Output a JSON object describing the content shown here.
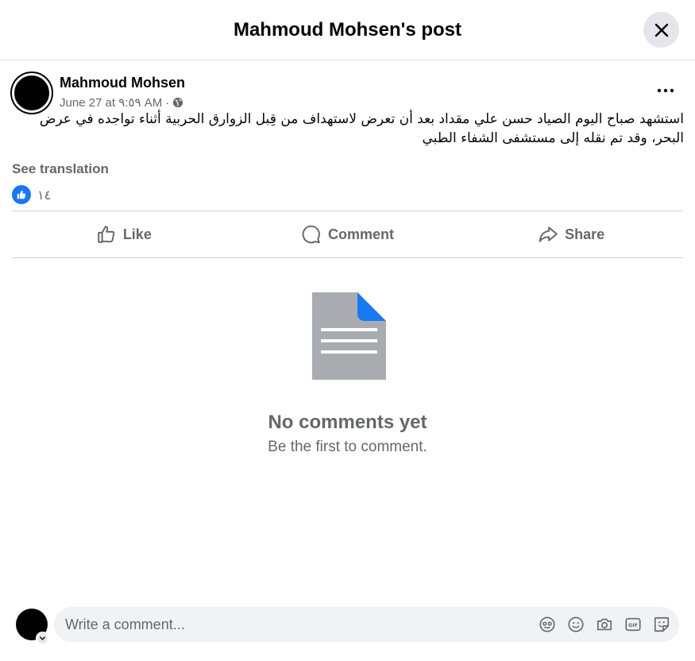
{
  "header": {
    "title": "Mahmoud Mohsen's post"
  },
  "post": {
    "author": "Mahmoud Mohsen",
    "date": "June 27 at ٩:٥٩ AM",
    "separator": "·",
    "text": "استشهد صباح اليوم الصياد حسن علي مقداد بعد أن تعرض لاستهداف من قِبل الزوارق الحربية أثناء تواجده في عرض البحر، وقد تم نقله إلى مستشفى الشفاء الطبي",
    "see_translation": "See translation",
    "reaction_count": "١٤"
  },
  "actions": {
    "like": "Like",
    "comment": "Comment",
    "share": "Share"
  },
  "empty_state": {
    "title": "No comments yet",
    "subtitle": "Be the first to comment."
  },
  "composer": {
    "placeholder": "Write a comment..."
  },
  "colors": {
    "accent": "#1877f2",
    "muted": "#65676b",
    "doc_gray": "#a8abaf"
  }
}
